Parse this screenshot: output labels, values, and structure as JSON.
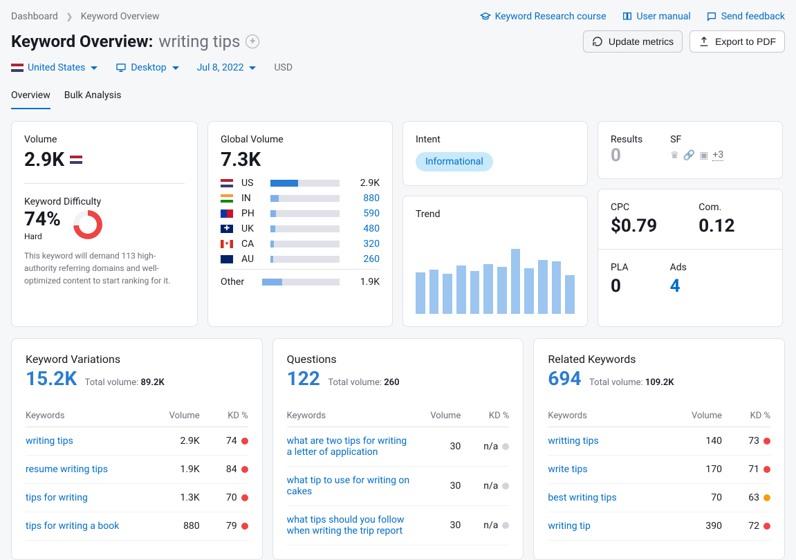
{
  "breadcrumbs": {
    "dashboard": "Dashboard",
    "current": "Keyword Overview"
  },
  "top_links": {
    "course": "Keyword Research course",
    "manual": "User manual",
    "feedback": "Send feedback"
  },
  "title": {
    "label": "Keyword Overview:",
    "keyword": "writing tips"
  },
  "actions": {
    "update": "Update metrics",
    "export": "Export to PDF"
  },
  "filters": {
    "country": "United States",
    "device": "Desktop",
    "date": "Jul 8, 2022",
    "currency": "USD"
  },
  "tabs": {
    "overview": "Overview",
    "bulk": "Bulk Analysis"
  },
  "volume": {
    "label": "Volume",
    "value": "2.9K"
  },
  "kd": {
    "label": "Keyword Difficulty",
    "value": "74%",
    "level": "Hard",
    "desc": "This keyword will demand 113 high-authority referring domains and well-optimized content to start ranking for it."
  },
  "gv": {
    "label": "Global Volume",
    "total": "7.3K",
    "rows": [
      {
        "cc": "US",
        "flag": "flag-us",
        "pct": 40,
        "val": "2.9K",
        "dark": true
      },
      {
        "cc": "IN",
        "flag": "flag-in",
        "pct": 12,
        "val": "880"
      },
      {
        "cc": "PH",
        "flag": "flag-ph",
        "pct": 8,
        "val": "590"
      },
      {
        "cc": "UK",
        "flag": "flag-uk",
        "pct": 7,
        "val": "480"
      },
      {
        "cc": "CA",
        "flag": "flag-ca",
        "pct": 5,
        "val": "320"
      },
      {
        "cc": "AU",
        "flag": "flag-au",
        "pct": 4,
        "val": "260"
      }
    ],
    "other_label": "Other",
    "other_pct": 26,
    "other_val": "1.9K"
  },
  "intent": {
    "label": "Intent",
    "value": "Informational"
  },
  "results": {
    "label": "Results",
    "value": "0"
  },
  "sf": {
    "label": "SF",
    "more": "+3"
  },
  "trend": {
    "label": "Trend"
  },
  "cpc": {
    "label": "CPC",
    "value": "$0.79"
  },
  "com": {
    "label": "Com.",
    "value": "0.12"
  },
  "pla": {
    "label": "PLA",
    "value": "0"
  },
  "ads": {
    "label": "Ads",
    "value": "4"
  },
  "table_headers": {
    "keywords": "Keywords",
    "volume": "Volume",
    "kd": "KD %"
  },
  "variations": {
    "title": "Keyword Variations",
    "count": "15.2K",
    "tv_label": "Total volume:",
    "tv_value": "89.2K",
    "rows": [
      {
        "kw": "writing tips",
        "vol": "2.9K",
        "kd": "74",
        "dot": "red"
      },
      {
        "kw": "resume writing tips",
        "vol": "1.9K",
        "kd": "84",
        "dot": "red"
      },
      {
        "kw": "tips for writing",
        "vol": "1.3K",
        "kd": "70",
        "dot": "red"
      },
      {
        "kw": "tips for writing a book",
        "vol": "880",
        "kd": "79",
        "dot": "red"
      }
    ]
  },
  "questions": {
    "title": "Questions",
    "count": "122",
    "tv_label": "Total volume:",
    "tv_value": "260",
    "rows": [
      {
        "kw": "what are two tips for writing a letter of application",
        "vol": "30",
        "kd": "n/a",
        "dot": "gray"
      },
      {
        "kw": "what tip to use for writing on cakes",
        "vol": "30",
        "kd": "n/a",
        "dot": "gray"
      },
      {
        "kw": "what tips should you follow when writing the trip report",
        "vol": "30",
        "kd": "n/a",
        "dot": "gray"
      }
    ]
  },
  "related": {
    "title": "Related Keywords",
    "count": "694",
    "tv_label": "Total volume:",
    "tv_value": "109.2K",
    "rows": [
      {
        "kw": "writting tips",
        "vol": "140",
        "kd": "73",
        "dot": "red"
      },
      {
        "kw": "write tips",
        "vol": "170",
        "kd": "71",
        "dot": "red"
      },
      {
        "kw": "best writing tips",
        "vol": "70",
        "kd": "63",
        "dot": "orange"
      },
      {
        "kw": "writing tip",
        "vol": "390",
        "kd": "72",
        "dot": "red"
      }
    ]
  },
  "chart_data": {
    "type": "bar",
    "title": "Trend",
    "values": [
      60,
      64,
      58,
      70,
      62,
      72,
      68,
      94,
      66,
      78,
      76,
      56
    ],
    "ylim": [
      0,
      100
    ]
  }
}
